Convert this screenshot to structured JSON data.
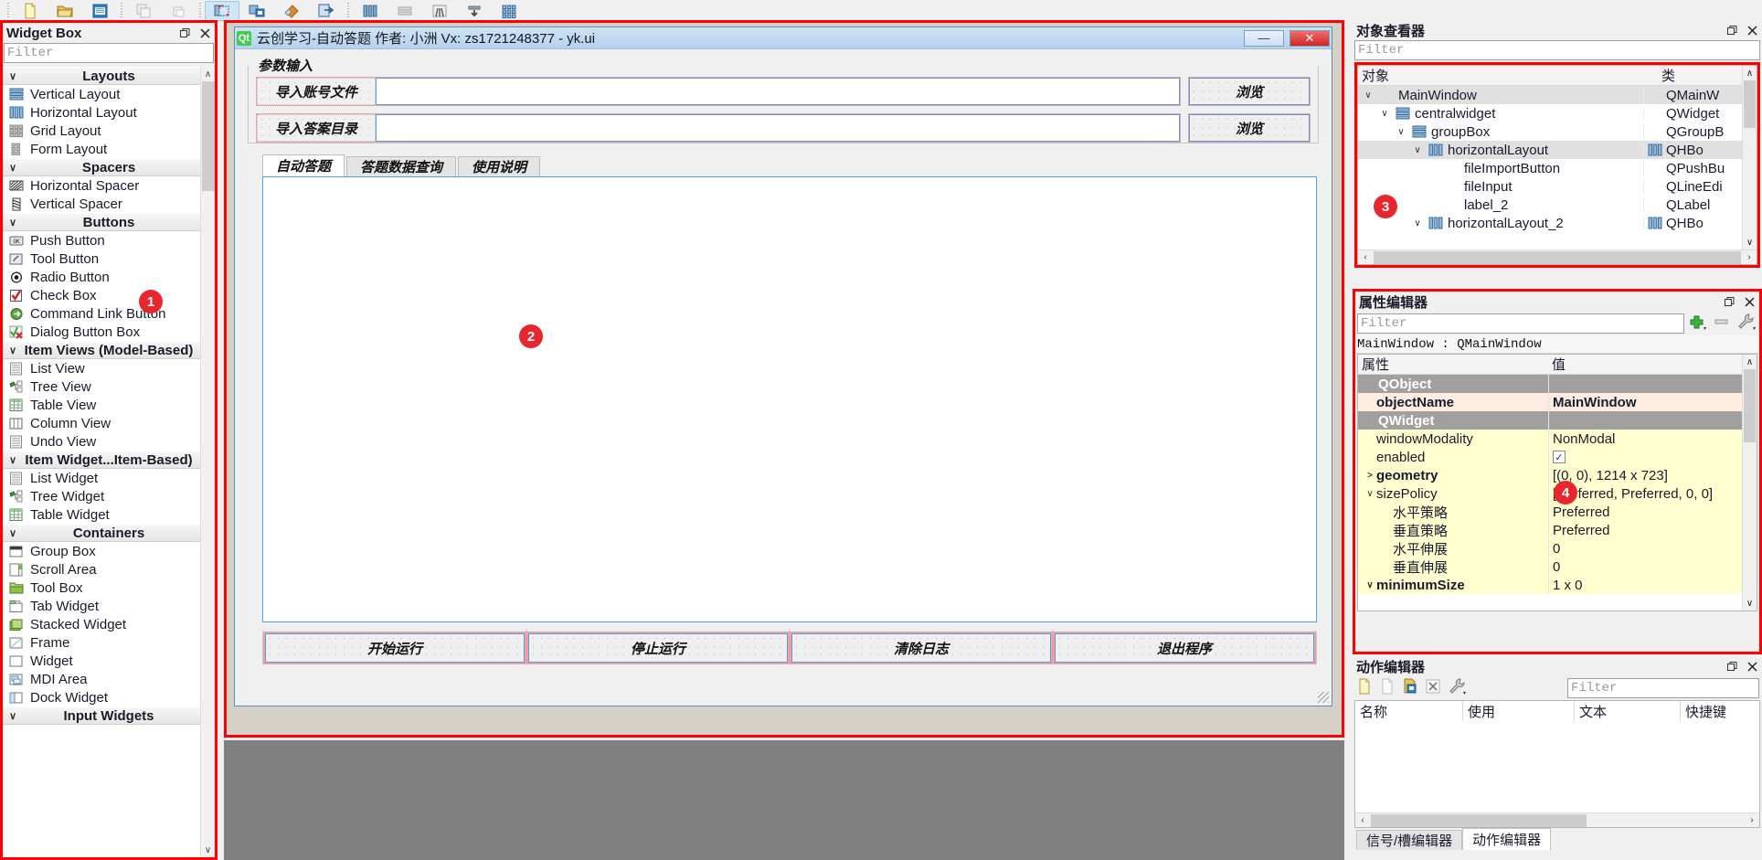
{
  "toolbar": {
    "icons": [
      "new-file-icon",
      "open-file-icon",
      "save-file-icon",
      "undo-icon",
      "redo-icon",
      "edit-widgets-icon",
      "edit-signals-icon",
      "edit-buddies-icon",
      "edit-tab-order-icon",
      "layout-horizontal-icon",
      "layout-vertical-icon",
      "layout-splitter-icon",
      "layout-form-icon",
      "layout-grid-icon"
    ]
  },
  "widget_box": {
    "title": "Widget Box",
    "filter_placeholder": "Filter",
    "float_icon": "restore-icon",
    "close_icon": "close-icon",
    "categories": [
      {
        "name": "Layouts",
        "items": [
          {
            "label": "Vertical Layout",
            "icon": "vertical-layout-icon"
          },
          {
            "label": "Horizontal Layout",
            "icon": "horizontal-layout-icon"
          },
          {
            "label": "Grid Layout",
            "icon": "grid-layout-icon"
          },
          {
            "label": "Form Layout",
            "icon": "form-layout-icon"
          }
        ]
      },
      {
        "name": "Spacers",
        "items": [
          {
            "label": "Horizontal Spacer",
            "icon": "horizontal-spacer-icon"
          },
          {
            "label": "Vertical Spacer",
            "icon": "vertical-spacer-icon"
          }
        ]
      },
      {
        "name": "Buttons",
        "items": [
          {
            "label": "Push Button",
            "icon": "push-button-icon"
          },
          {
            "label": "Tool Button",
            "icon": "tool-button-icon"
          },
          {
            "label": "Radio Button",
            "icon": "radio-button-icon"
          },
          {
            "label": "Check Box",
            "icon": "check-box-icon"
          },
          {
            "label": "Command Link Button",
            "icon": "command-link-icon"
          },
          {
            "label": "Dialog Button Box",
            "icon": "dialog-button-box-icon"
          }
        ]
      },
      {
        "name": "Item Views (Model-Based)",
        "items": [
          {
            "label": "List View",
            "icon": "list-view-icon"
          },
          {
            "label": "Tree View",
            "icon": "tree-view-icon"
          },
          {
            "label": "Table View",
            "icon": "table-view-icon"
          },
          {
            "label": "Column View",
            "icon": "column-view-icon"
          },
          {
            "label": "Undo View",
            "icon": "undo-view-icon"
          }
        ]
      },
      {
        "name": "Item Widget...Item-Based)",
        "items": [
          {
            "label": "List Widget",
            "icon": "list-widget-icon"
          },
          {
            "label": "Tree Widget",
            "icon": "tree-widget-icon"
          },
          {
            "label": "Table Widget",
            "icon": "table-widget-icon"
          }
        ]
      },
      {
        "name": "Containers",
        "items": [
          {
            "label": "Group Box",
            "icon": "group-box-icon"
          },
          {
            "label": "Scroll Area",
            "icon": "scroll-area-icon"
          },
          {
            "label": "Tool Box",
            "icon": "tool-box-icon"
          },
          {
            "label": "Tab Widget",
            "icon": "tab-widget-icon"
          },
          {
            "label": "Stacked Widget",
            "icon": "stacked-widget-icon"
          },
          {
            "label": "Frame",
            "icon": "frame-icon"
          },
          {
            "label": "Widget",
            "icon": "widget-icon"
          },
          {
            "label": "MDI Area",
            "icon": "mdi-area-icon"
          },
          {
            "label": "Dock Widget",
            "icon": "dock-widget-icon"
          }
        ]
      },
      {
        "name": "Input Widgets",
        "items": []
      }
    ]
  },
  "form": {
    "title": "云创学习-自动答题 作者: 小洲  Vx: zs1721248377 - yk.ui",
    "logo_text": "Qt",
    "minimize_label": "—",
    "close_label": "✕",
    "groupbox_title": "参数输入",
    "fields": [
      {
        "label": "导入账号文件",
        "value": "",
        "button": "浏览"
      },
      {
        "label": "导入答案目录",
        "value": "",
        "button": "浏览"
      }
    ],
    "tabs": [
      {
        "label": "自动答题",
        "active": true
      },
      {
        "label": "答题数据查询",
        "active": false
      },
      {
        "label": "使用说明",
        "active": false
      }
    ],
    "log_text": "",
    "buttons": [
      "开始运行",
      "停止运行",
      "清除日志",
      "退出程序"
    ]
  },
  "markers": [
    {
      "id": "1",
      "label": "1"
    },
    {
      "id": "2",
      "label": "2"
    },
    {
      "id": "3",
      "label": "3"
    },
    {
      "id": "4",
      "label": "4"
    }
  ],
  "object_inspector": {
    "title": "对象查看器",
    "filter_placeholder": "Filter",
    "columns": [
      "对象",
      "类"
    ],
    "rows": [
      {
        "indent": 0,
        "chevron": "v",
        "icon": "",
        "name": "MainWindow",
        "cls": "QMainW",
        "cls_icon": "",
        "selected": true
      },
      {
        "indent": 1,
        "chevron": "v",
        "icon": "vertical-layout-icon",
        "name": "centralwidget",
        "cls": "QWidget",
        "cls_icon": "",
        "selected": false
      },
      {
        "indent": 2,
        "chevron": "v",
        "icon": "vertical-layout-icon",
        "name": "groupBox",
        "cls": "QGroupB",
        "cls_icon": "",
        "selected": false
      },
      {
        "indent": 3,
        "chevron": "v",
        "icon": "horizontal-layout-icon",
        "name": "horizontalLayout",
        "cls": "QHBo",
        "cls_icon": "horizontal-layout-icon",
        "selected": true
      },
      {
        "indent": 4,
        "chevron": "",
        "icon": "",
        "name": "fileImportButton",
        "cls": "QPushBu",
        "cls_icon": "",
        "selected": false
      },
      {
        "indent": 4,
        "chevron": "",
        "icon": "",
        "name": "fileInput",
        "cls": "QLineEdi",
        "cls_icon": "",
        "selected": false
      },
      {
        "indent": 4,
        "chevron": "",
        "icon": "",
        "name": "label_2",
        "cls": "QLabel",
        "cls_icon": "",
        "selected": false
      },
      {
        "indent": 3,
        "chevron": "v",
        "icon": "horizontal-layout-icon",
        "name": "horizontalLayout_2",
        "cls": "QHBo",
        "cls_icon": "horizontal-layout-icon",
        "selected": false
      }
    ]
  },
  "property_editor": {
    "title": "属性编辑器",
    "filter_placeholder": "Filter",
    "tools": [
      "add-icon",
      "remove-icon",
      "configure-icon"
    ],
    "object_line": "MainWindow : QMainWindow",
    "columns": [
      "属性",
      "值"
    ],
    "rows": [
      {
        "kind": "group",
        "key": "QObject",
        "value": ""
      },
      {
        "kind": "obj",
        "key": "objectName",
        "value": "MainWindow"
      },
      {
        "kind": "group",
        "key": "QWidget",
        "value": ""
      },
      {
        "kind": "yel",
        "key": "windowModality",
        "value": "NonModal"
      },
      {
        "kind": "check",
        "key": "enabled",
        "value": "✓"
      },
      {
        "kind": "yel-b",
        "key": "geometry",
        "value": "[(0, 0), 1214 x 723]",
        "chev": ">"
      },
      {
        "kind": "yel",
        "key": "sizePolicy",
        "value": "[Preferred, Preferred, 0, 0]",
        "chev": "v"
      },
      {
        "kind": "yel-i",
        "key": "水平策略",
        "value": "Preferred"
      },
      {
        "kind": "yel-i",
        "key": "垂直策略",
        "value": "Preferred"
      },
      {
        "kind": "yel-i",
        "key": "水平伸展",
        "value": "0"
      },
      {
        "kind": "yel-i",
        "key": "垂直伸展",
        "value": "0"
      },
      {
        "kind": "yel-b",
        "key": "minimumSize",
        "value": "1 x 0",
        "chev": "v"
      }
    ]
  },
  "action_editor": {
    "title": "动作编辑器",
    "filter_placeholder": "Filter",
    "tools": [
      "new-action-icon",
      "copy-action-icon",
      "paste-action-icon",
      "delete-action-icon",
      "configure-icon"
    ],
    "columns": [
      "名称",
      "使用",
      "文本",
      "快捷键"
    ],
    "rows": [],
    "bottom_tabs": [
      {
        "label": "信号/槽编辑器",
        "active": false
      },
      {
        "label": "动作编辑器",
        "active": true
      }
    ]
  },
  "colors": {
    "marker_red": "#e8262d",
    "highlight_red": "#ff0000",
    "selection_blue": "#4aa3df",
    "property_yellow": "#ffffd0",
    "group_gray": "#a0a0a0"
  }
}
